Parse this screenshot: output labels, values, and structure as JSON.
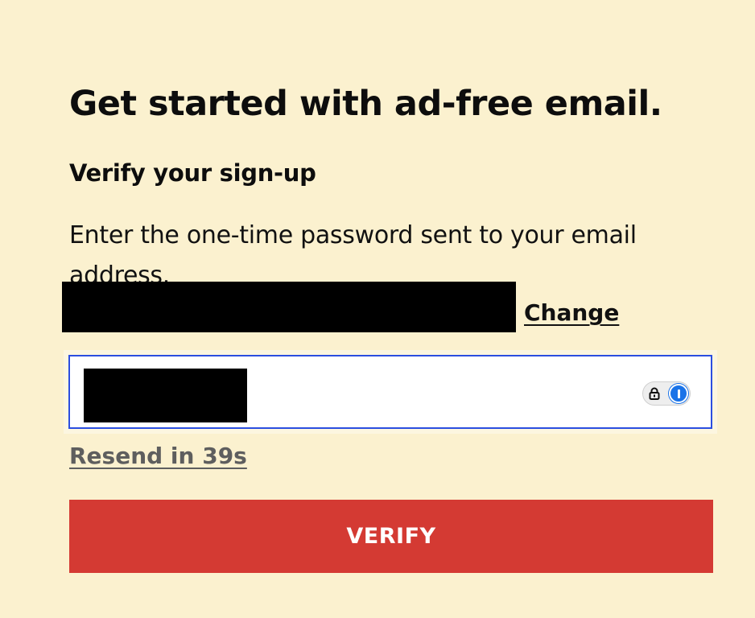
{
  "page": {
    "title": "Get started with ad-free email.",
    "subtitle": "Verify your sign-up",
    "instruction": "Enter the one-time password sent to your email address."
  },
  "email": {
    "change_label": "Change"
  },
  "otp": {
    "value": "",
    "password_manager_icons": [
      "lock-icon",
      "1password-icon"
    ]
  },
  "resend": {
    "label": "Resend in 39s"
  },
  "actions": {
    "verify_label": "VERIFY"
  },
  "colors": {
    "background": "#fbf1cf",
    "accent": "#d43a33",
    "focus_border": "#2b4ee0"
  }
}
